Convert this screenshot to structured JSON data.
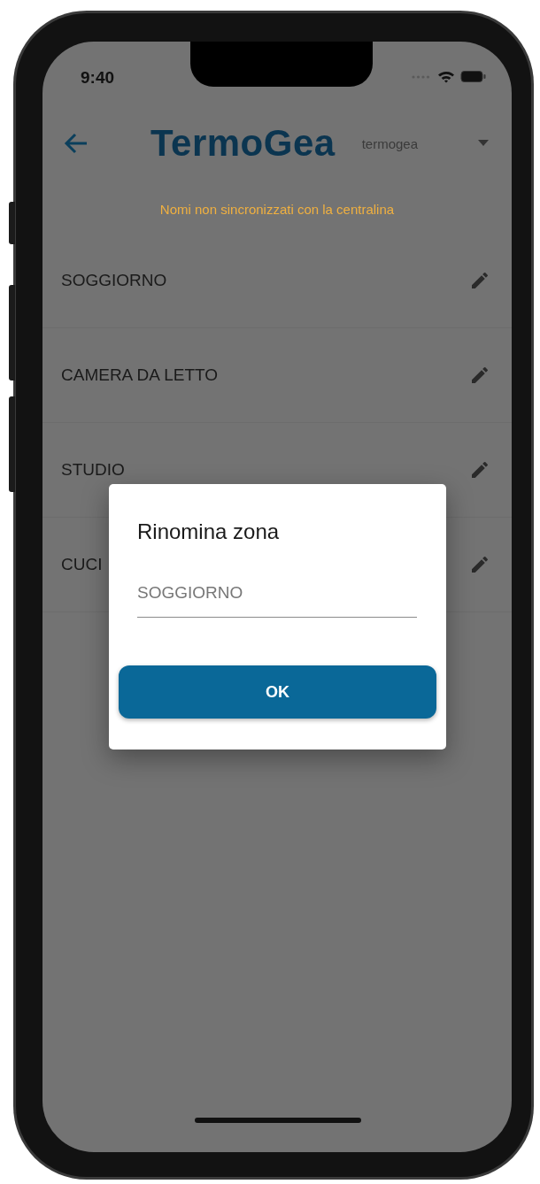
{
  "status_bar": {
    "time": "9:40"
  },
  "header": {
    "logo": "TermoGea",
    "account": "termogea"
  },
  "warning": "Nomi non sincronizzati con la centralina",
  "zones": [
    {
      "name": "SOGGIORNO"
    },
    {
      "name": "CAMERA DA LETTO"
    },
    {
      "name": "STUDIO"
    },
    {
      "name": "CUCI"
    }
  ],
  "dialog": {
    "title": "Rinomina zona",
    "field": {
      "placeholder": "SOGGIORNO"
    },
    "button": "OK"
  }
}
